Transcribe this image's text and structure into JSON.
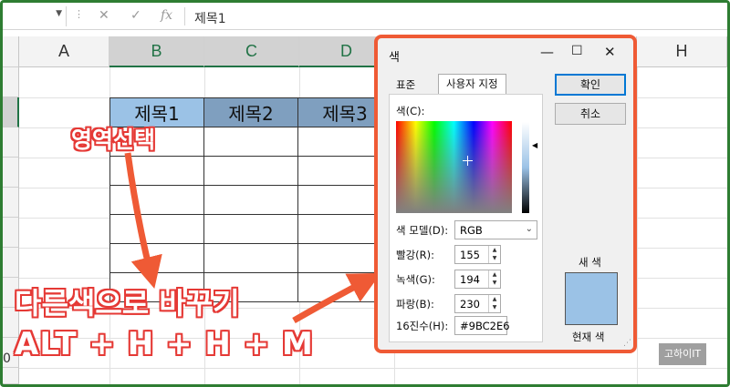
{
  "formula_bar": {
    "name_box": "",
    "content": "제목1",
    "fx_label": "fx"
  },
  "sheet": {
    "columns": [
      "A",
      "B",
      "C",
      "D",
      "H"
    ],
    "headers": [
      "제목1",
      "제목2",
      "제목3"
    ],
    "row_fragment": "0"
  },
  "annotations": {
    "select_range": "영역선택",
    "change_color": "다른색으로 바꾸기",
    "shortcut": "ALT + H + H + M"
  },
  "dialog": {
    "title": "색",
    "tabs": [
      "표준",
      "사용자 지정"
    ],
    "color_label": "색(C):",
    "model_label": "색 모델(D):",
    "model_value": "RGB",
    "red_label": "빨강(R):",
    "red_value": "155",
    "green_label": "녹색(G):",
    "green_value": "194",
    "blue_label": "파랑(B):",
    "blue_value": "230",
    "hex_label": "16진수(H):",
    "hex_value": "#9BC2E6",
    "ok_label": "확인",
    "cancel_label": "취소",
    "new_label": "새 색",
    "current_label": "현재 색",
    "swatch_color": "#9BC2E6"
  },
  "watermark": "고하이IT",
  "colors": {
    "accent": "#217346",
    "annotation": "#e53935",
    "dialog_border": "#ef5a35",
    "header_fill": "#9bc2e6"
  }
}
